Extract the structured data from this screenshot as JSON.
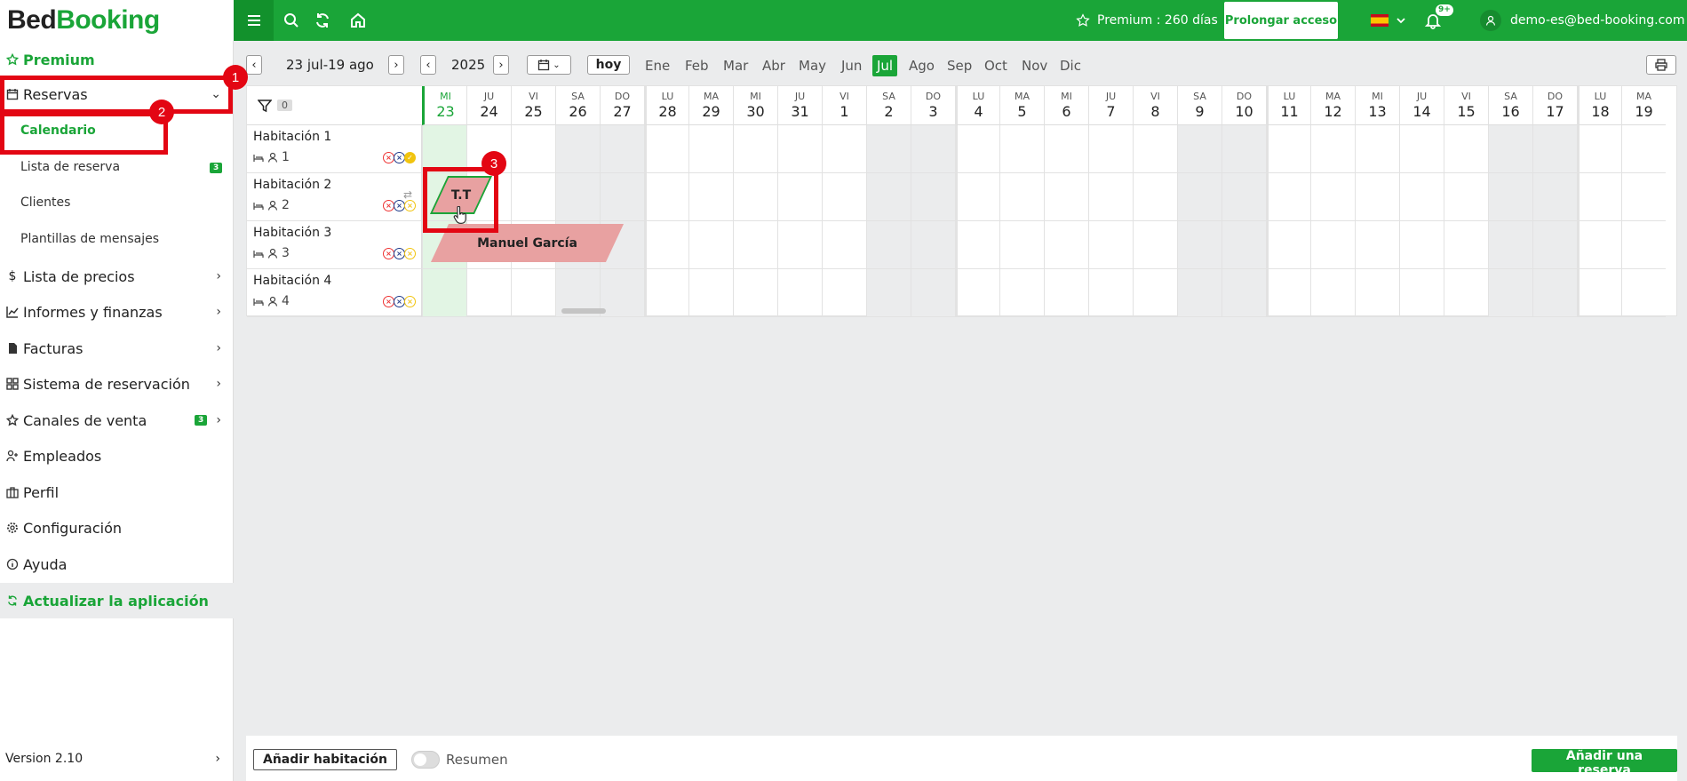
{
  "logo": {
    "part1": "Bed",
    "part2": "Booking"
  },
  "topbar": {
    "premium_text": "Premium : 260 días",
    "prolong_label": "Prolongar acceso",
    "notif_badge": "9+",
    "user_email": "demo-es@bed-booking.com"
  },
  "sidebar": {
    "premium": "Premium",
    "reservas": "Reservas",
    "calendario": "Calendario",
    "lista_reserva": "Lista de reserva",
    "lista_reserva_badge": "3",
    "clientes": "Clientes",
    "plantillas": "Plantillas de mensajes",
    "precios": "Lista de precios",
    "informes": "Informes y finanzas",
    "facturas": "Facturas",
    "sistema": "Sistema de reservación",
    "canales": "Canales de venta",
    "canales_badge": "3",
    "empleados": "Empleados",
    "perfil": "Perfil",
    "config": "Configuración",
    "ayuda": "Ayuda",
    "actualizar": "Actualizar la aplicación",
    "version": "Version 2.10"
  },
  "toolbar": {
    "date_range": "23 jul-19 ago",
    "year": "2025",
    "today_btn": "hoy",
    "months": [
      "Ene",
      "Feb",
      "Mar",
      "Abr",
      "May",
      "Jun",
      "Jul",
      "Ago",
      "Sep",
      "Oct",
      "Nov",
      "Dic"
    ],
    "active_month": "Jul"
  },
  "calendar": {
    "filter_count": "0",
    "days": [
      {
        "n": "MI",
        "d": "23"
      },
      {
        "n": "JU",
        "d": "24"
      },
      {
        "n": "VI",
        "d": "25"
      },
      {
        "n": "SA",
        "d": "26"
      },
      {
        "n": "DO",
        "d": "27"
      },
      {
        "n": "LU",
        "d": "28"
      },
      {
        "n": "MA",
        "d": "29"
      },
      {
        "n": "MI",
        "d": "30"
      },
      {
        "n": "JU",
        "d": "31"
      },
      {
        "n": "VI",
        "d": "1"
      },
      {
        "n": "SA",
        "d": "2"
      },
      {
        "n": "DO",
        "d": "3"
      },
      {
        "n": "LU",
        "d": "4"
      },
      {
        "n": "MA",
        "d": "5"
      },
      {
        "n": "MI",
        "d": "6"
      },
      {
        "n": "JU",
        "d": "7"
      },
      {
        "n": "VI",
        "d": "8"
      },
      {
        "n": "SA",
        "d": "9"
      },
      {
        "n": "DO",
        "d": "10"
      },
      {
        "n": "LU",
        "d": "11"
      },
      {
        "n": "MA",
        "d": "12"
      },
      {
        "n": "MI",
        "d": "13"
      },
      {
        "n": "JU",
        "d": "14"
      },
      {
        "n": "VI",
        "d": "15"
      },
      {
        "n": "SA",
        "d": "16"
      },
      {
        "n": "DO",
        "d": "17"
      },
      {
        "n": "LU",
        "d": "18"
      },
      {
        "n": "MA",
        "d": "19"
      }
    ],
    "rooms": [
      {
        "name": "Habitación 1",
        "capacity": "1"
      },
      {
        "name": "Habitación 2",
        "capacity": "2"
      },
      {
        "name": "Habitación 3",
        "capacity": "3"
      },
      {
        "name": "Habitación 4",
        "capacity": "4"
      }
    ],
    "bookings": [
      {
        "label": "T.T",
        "room": "Habitación 2"
      },
      {
        "label": "Manuel García",
        "room": "Habitación 3"
      }
    ]
  },
  "annotations": [
    "1",
    "2",
    "3"
  ],
  "footer": {
    "add_room": "Añadir habitación",
    "summary": "Resumen",
    "add_reservation": "Añadir una reserva"
  },
  "colors": {
    "brand": "#1aa538",
    "booking": "#e8a1a1",
    "annotation": "#e30613"
  }
}
